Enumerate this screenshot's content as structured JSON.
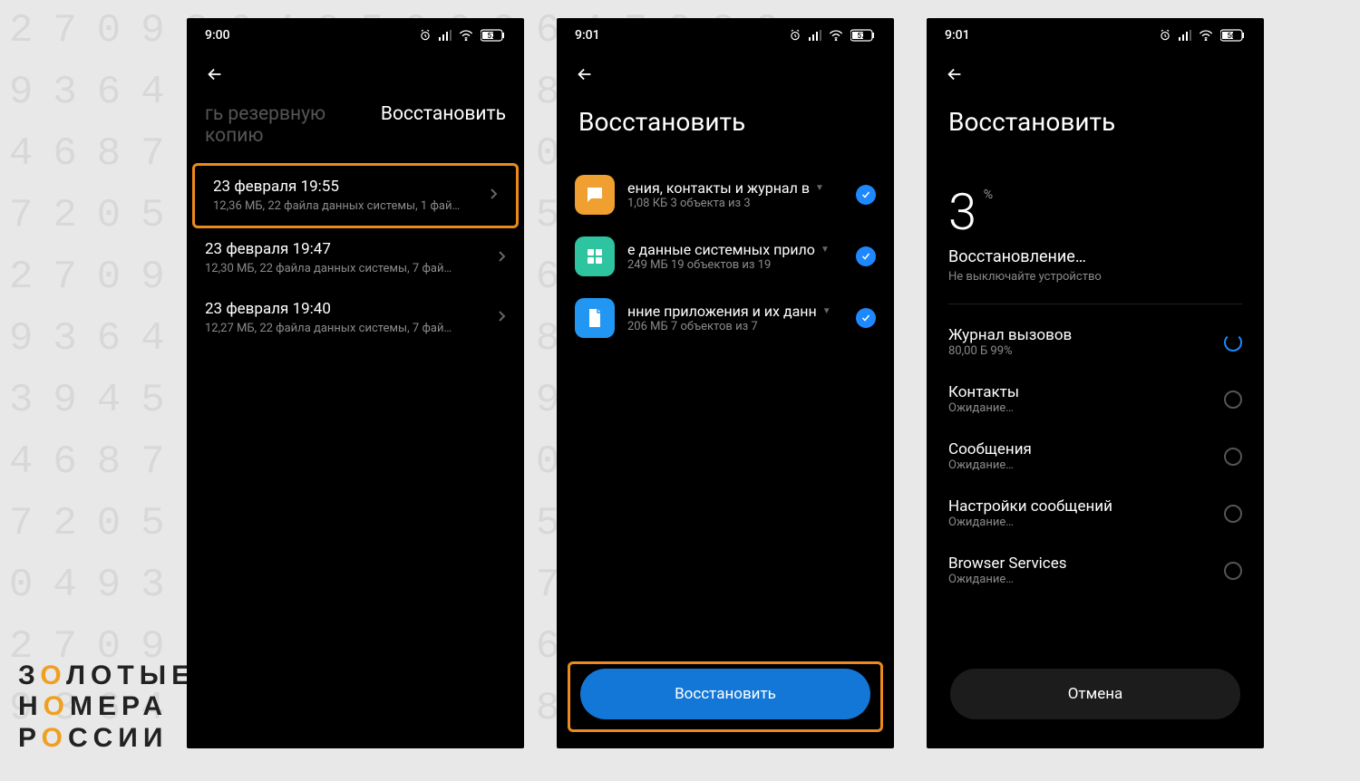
{
  "bg_digits": "270936485093647283\n936401573927845091\n468725309123067842\n720583649284511037\n270936485093647283\n936401573927845091\n394561487203974650\n468725309123067842\n720583649284511037\n049346789231742364\n270936485093647283\n936401573927845091",
  "logo": {
    "line1_pre": "З",
    "line1_accent": "О",
    "line1_post": "ЛОТЫЕ",
    "line2_pre": "Н",
    "line2_accent": "О",
    "line2_post": "МЕРА",
    "line3_pre": "Р",
    "line3_accent": "О",
    "line3_post": "ССИИ"
  },
  "screen1": {
    "time": "9:00",
    "battery": "57",
    "tabs": {
      "left": "гь резервную копию",
      "right": "Восстановить"
    },
    "items": [
      {
        "title": "23 февраля 19:55",
        "sub": "12,36 МБ, 22 файла данных системы, 1 фай…"
      },
      {
        "title": "23 февраля 19:47",
        "sub": "12,30 МБ, 22 файла данных системы, 7 фай…"
      },
      {
        "title": "23 февраля 19:40",
        "sub": "12,27 МБ, 22 файла данных системы, 7 фай…"
      }
    ]
  },
  "screen2": {
    "time": "9:01",
    "battery": "57",
    "title": "Восстановить",
    "cats": [
      {
        "title": "ения, контакты и журнал в",
        "sub": "1,08 КБ  3 объекта из 3"
      },
      {
        "title": "е данные системных прило",
        "sub": "249 МБ  19 объектов из 19"
      },
      {
        "title": "нние приложения и их данн",
        "sub": "206 МБ  7 объектов из 7"
      }
    ],
    "button": "Восстановить"
  },
  "screen3": {
    "time": "9:01",
    "battery": "56",
    "title": "Восстановить",
    "percent": "3",
    "percent_sym": "%",
    "status": "Восстановление…",
    "status_sub": "Не выключайте устройство",
    "rows": [
      {
        "title": "Журнал вызовов",
        "sub": "80,00 Б 99%",
        "active": true
      },
      {
        "title": "Контакты",
        "sub": "Ожидание…",
        "active": false
      },
      {
        "title": "Сообщения",
        "sub": "Ожидание…",
        "active": false
      },
      {
        "title": "Настройки сообщений",
        "sub": "Ожидание…",
        "active": false
      },
      {
        "title": "Browser Services",
        "sub": "Ожидание…",
        "active": false
      }
    ],
    "button": "Отмена"
  }
}
